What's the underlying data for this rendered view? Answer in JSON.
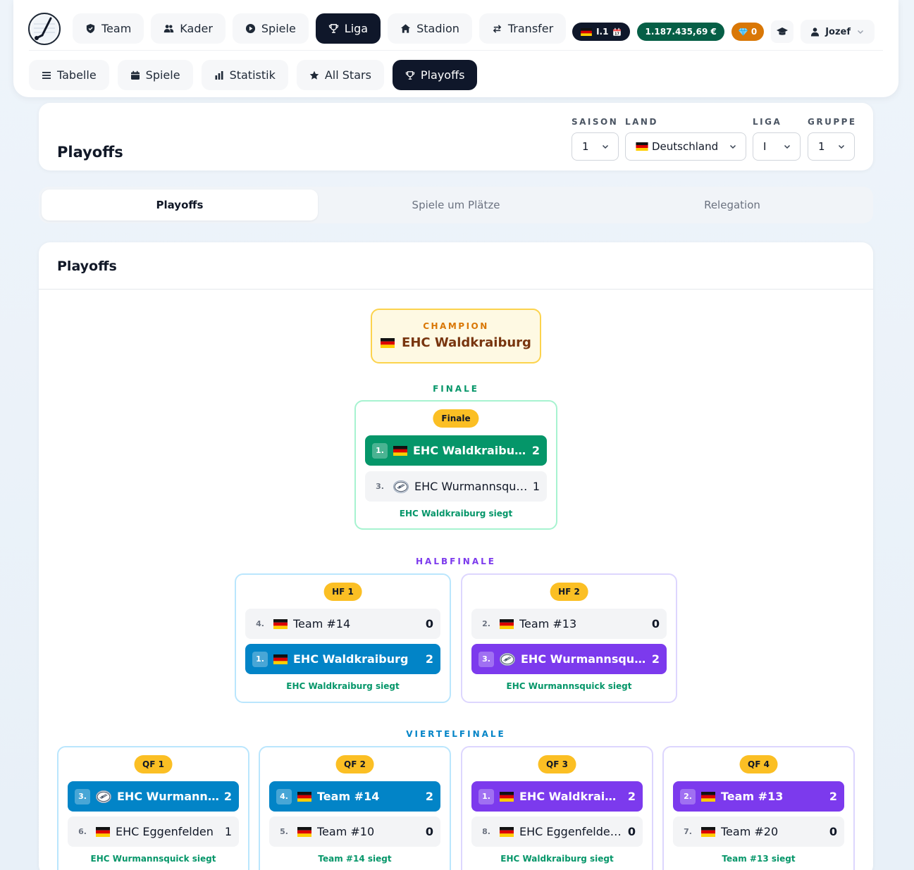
{
  "nav": {
    "items": [
      {
        "label": "Team",
        "icon": "shield-icon",
        "active": false
      },
      {
        "label": "Kader",
        "icon": "users-icon",
        "active": false
      },
      {
        "label": "Spiele",
        "icon": "play-circle-icon",
        "active": false
      },
      {
        "label": "Liga",
        "icon": "trophy-icon",
        "active": true
      },
      {
        "label": "Stadion",
        "icon": "home-icon",
        "active": false
      },
      {
        "label": "Transfer",
        "icon": "transfer-icon",
        "active": false
      }
    ],
    "league_pill": "I.1",
    "money": "1.187.435,69 €",
    "gems": "0",
    "user": "Jozef"
  },
  "subnav": {
    "items": [
      {
        "label": "Tabelle",
        "icon": "list-icon",
        "active": false
      },
      {
        "label": "Spiele",
        "icon": "calendar-icon",
        "active": false
      },
      {
        "label": "Statistik",
        "icon": "bar-chart-icon",
        "active": false
      },
      {
        "label": "All Stars",
        "icon": "star-icon",
        "active": false
      },
      {
        "label": "Playoffs",
        "icon": "trophy-icon",
        "active": true
      }
    ]
  },
  "header": {
    "title": "Playoffs",
    "filters": {
      "saison": {
        "label": "SAISON",
        "value": "1"
      },
      "land": {
        "label": "LAND",
        "value": "Deutschland"
      },
      "liga": {
        "label": "LIGA",
        "value": "I"
      },
      "gruppe": {
        "label": "GRUPPE",
        "value": "1"
      }
    }
  },
  "tabs": [
    "Playoffs",
    "Spiele um Plätze",
    "Relegation"
  ],
  "bracket": {
    "title": "Playoffs",
    "champion_label": "CHAMPION",
    "champion": "EHC Waldkraiburg",
    "rounds": {
      "finale_label": "FINALE",
      "halbfinale_label": "HALBFINALE",
      "viertelfinale_label": "VIERTELFINALE"
    },
    "finale": {
      "badge": "Finale",
      "rows": [
        {
          "seed": "1.",
          "team": "EHC Waldkraiburg",
          "score": "2"
        },
        {
          "seed": "3.",
          "team": "EHC Wurmannsquick",
          "score": "1"
        }
      ],
      "winner": "EHC Waldkraiburg siegt"
    },
    "hf1": {
      "badge": "HF 1",
      "rows": [
        {
          "seed": "4.",
          "team": "Team #14",
          "score": "0"
        },
        {
          "seed": "1.",
          "team": "EHC Waldkraiburg",
          "score": "2"
        }
      ],
      "winner": "EHC Waldkraiburg siegt"
    },
    "hf2": {
      "badge": "HF 2",
      "rows": [
        {
          "seed": "2.",
          "team": "Team #13",
          "score": "0"
        },
        {
          "seed": "3.",
          "team": "EHC Wurmannsquick",
          "score": "2"
        }
      ],
      "winner": "EHC Wurmannsquick siegt"
    },
    "qf1": {
      "badge": "QF 1",
      "rows": [
        {
          "seed": "3.",
          "team": "EHC Wurmannsquick",
          "score": "2"
        },
        {
          "seed": "6.",
          "team": "EHC Eggenfelden",
          "score": "1"
        }
      ],
      "winner": "EHC Wurmannsquick siegt"
    },
    "qf2": {
      "badge": "QF 2",
      "rows": [
        {
          "seed": "4.",
          "team": "Team #14",
          "score": "2"
        },
        {
          "seed": "5.",
          "team": "Team #10",
          "score": "0"
        }
      ],
      "winner": "Team #14 siegt"
    },
    "qf3": {
      "badge": "QF 3",
      "rows": [
        {
          "seed": "1.",
          "team": "EHC Waldkraiburg",
          "score": "2"
        },
        {
          "seed": "8.",
          "team": "EHC Eggenfelden II",
          "score": "0"
        }
      ],
      "winner": "EHC Waldkraiburg siegt"
    },
    "qf4": {
      "badge": "QF 4",
      "rows": [
        {
          "seed": "2.",
          "team": "Team #13",
          "score": "2"
        },
        {
          "seed": "7.",
          "team": "Team #20",
          "score": "0"
        }
      ],
      "winner": "Team #13 siegt"
    }
  },
  "colors": {
    "dark": "#0f172a",
    "green": "#059669",
    "blue": "#0284c7",
    "purple": "#7c3aed",
    "badge": "#fbbf24",
    "champion_border": "#fcd34d"
  }
}
